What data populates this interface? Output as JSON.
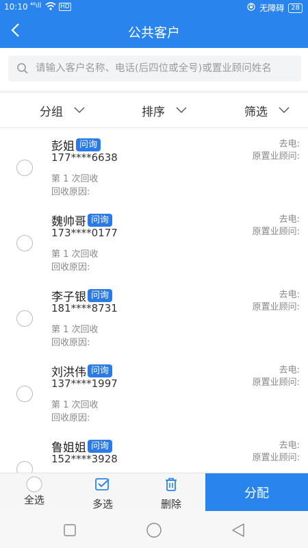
{
  "status": {
    "time": "10:10",
    "signal": "⁴⁶ıll",
    "hd": "HD",
    "accessibility": "无障碍",
    "battery": "28"
  },
  "header": {
    "title": "公共客户"
  },
  "search": {
    "placeholder": "请输入客户名称、电话(后四位或全号)或置业顾问姓名"
  },
  "filters": [
    {
      "label": "分组"
    },
    {
      "label": "排序"
    },
    {
      "label": "筛选"
    }
  ],
  "customers": [
    {
      "name": "彭姐",
      "tag": "问询",
      "phone": "177****6638",
      "count": "第 1 次回收",
      "reason": "回收原因:",
      "call": "去电:",
      "adviser": "原置业顾问:"
    },
    {
      "name": "魏帅哥",
      "tag": "问询",
      "phone": "173****0177",
      "count": "第 1 次回收",
      "reason": "回收原因:",
      "call": "去电:",
      "adviser": "原置业顾问:"
    },
    {
      "name": "李子银",
      "tag": "问询",
      "phone": "181****8731",
      "count": "第 1 次回收",
      "reason": "回收原因:",
      "call": "去电:",
      "adviser": "原置业顾问:"
    },
    {
      "name": "刘洪伟",
      "tag": "问询",
      "phone": "137****1997",
      "count": "第 1 次回收",
      "reason": "回收原因:",
      "call": "去电:",
      "adviser": "原置业顾问:"
    },
    {
      "name": "鲁姐姐",
      "tag": "问询",
      "phone": "152****3928",
      "count": "",
      "reason": "",
      "call": "去电:",
      "adviser": "原置业顾问:"
    }
  ],
  "bottom": {
    "select_all": "全选",
    "multi_select": "多选",
    "delete": "删除",
    "assign": "分配"
  },
  "colors": {
    "primary": "#2a84ee",
    "badge": "#2a7ae8"
  }
}
